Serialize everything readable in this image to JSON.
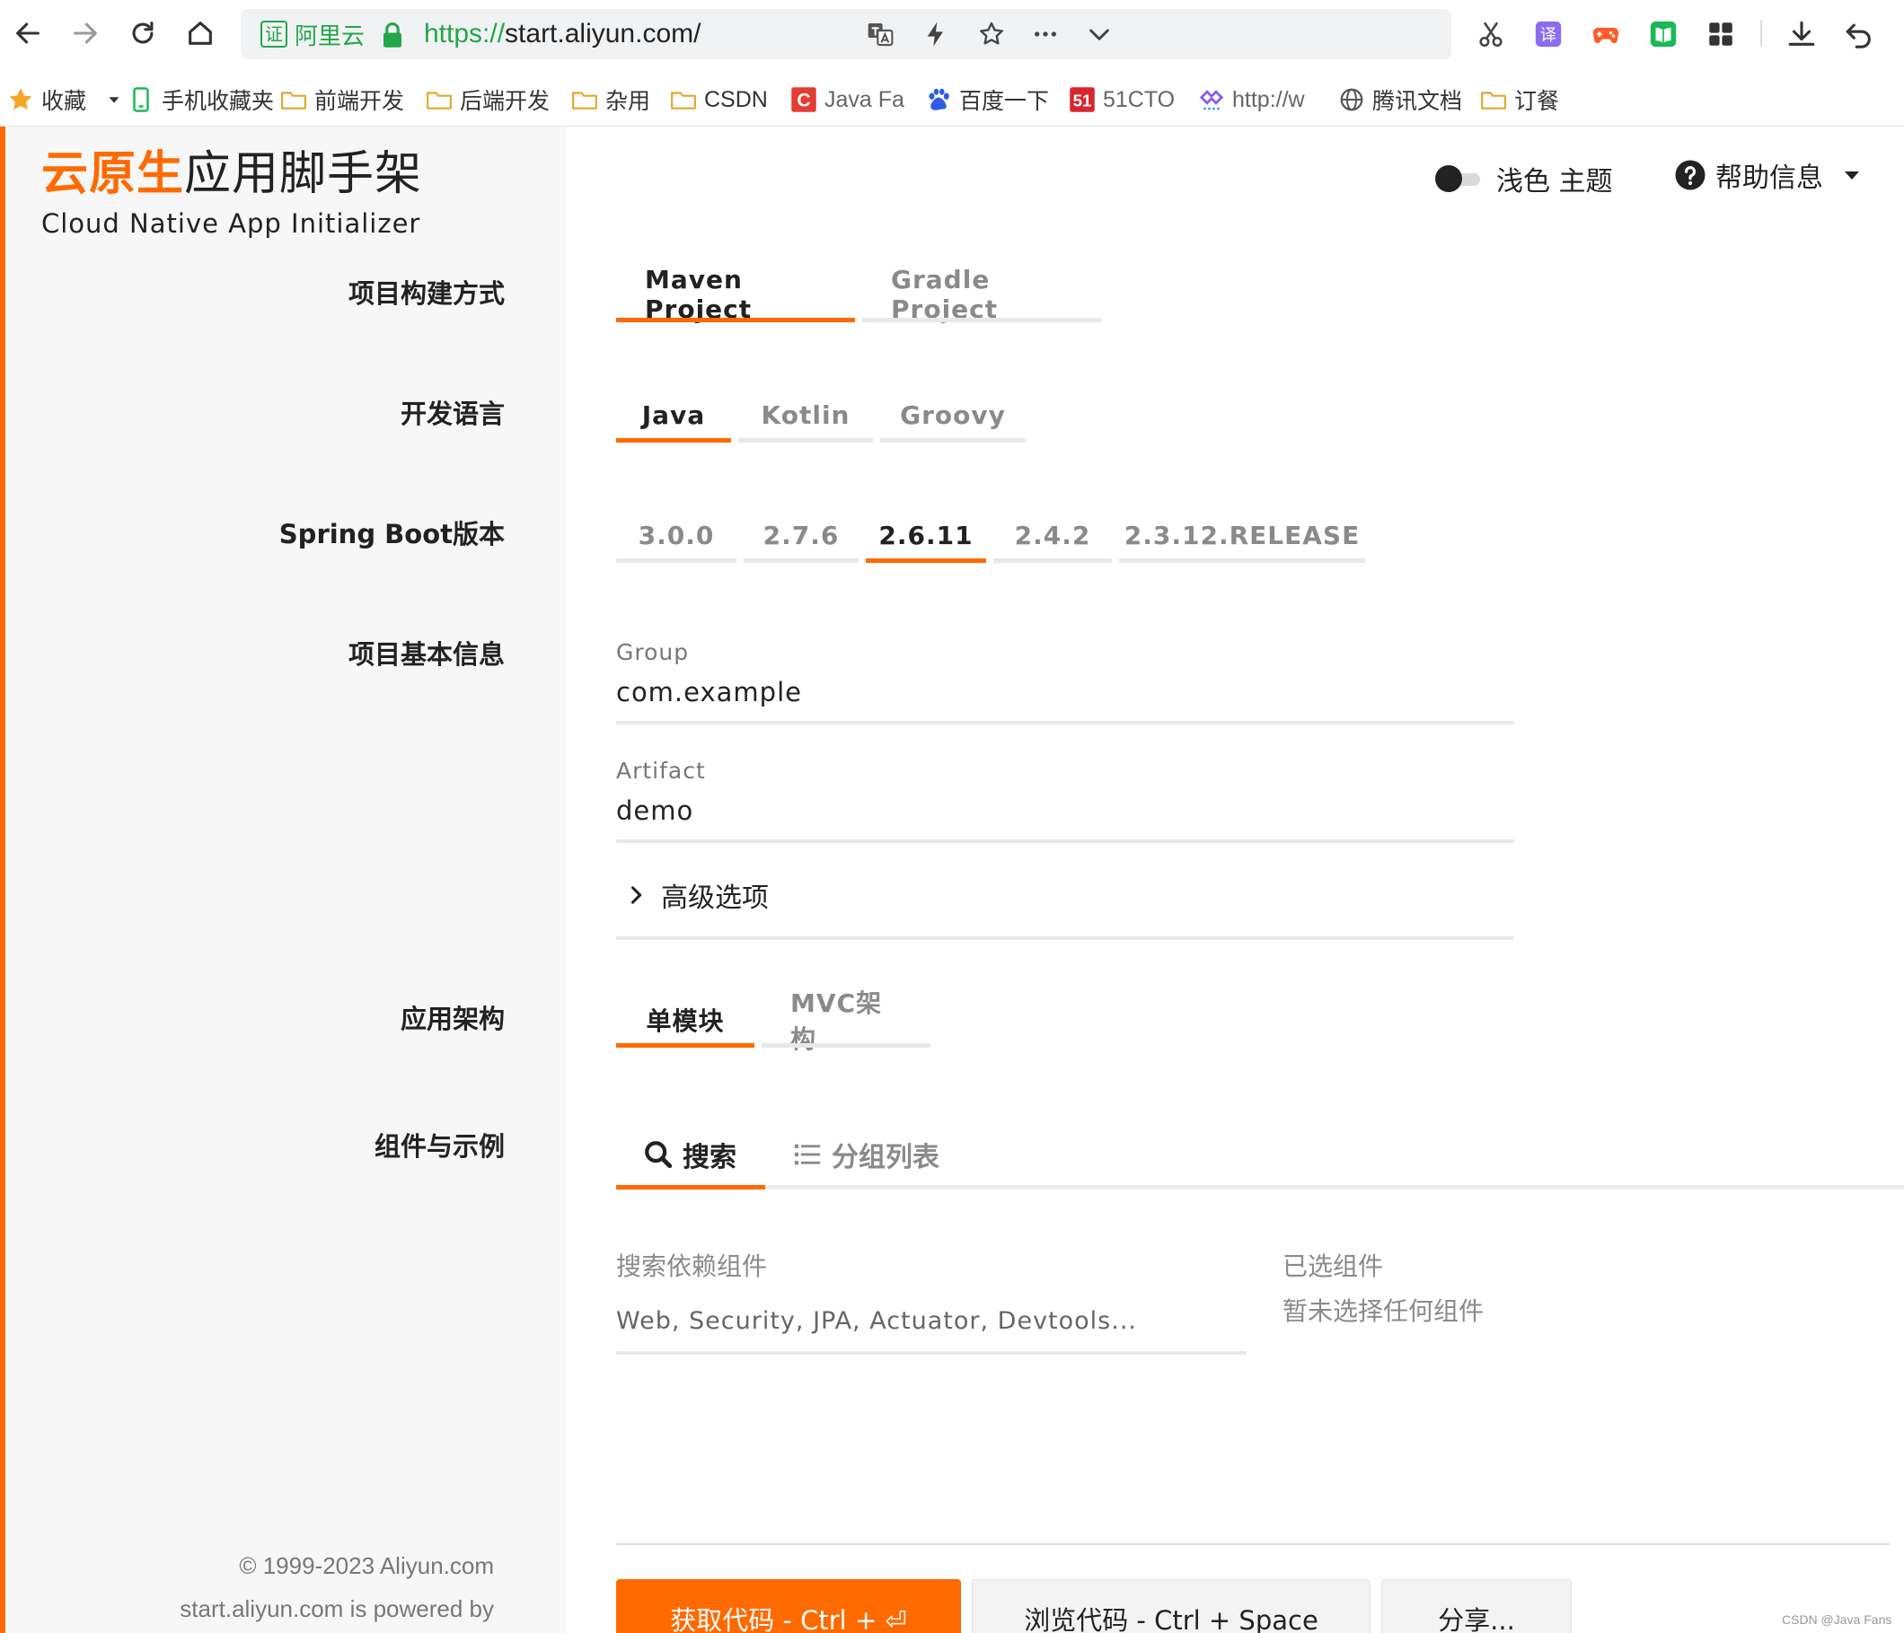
{
  "browser": {
    "cert_label": "阿里云",
    "cert_char": "证",
    "url_protocol": "https://",
    "url_rest": "start.aliyun.com/",
    "bookmarks": [
      {
        "label": "收藏",
        "icon": "star-icon"
      },
      {
        "label": "手机收藏夹",
        "icon": "phone-icon"
      },
      {
        "label": "前端开发",
        "icon": "folder-icon"
      },
      {
        "label": "后端开发",
        "icon": "folder-icon"
      },
      {
        "label": "杂用",
        "icon": "folder-icon"
      },
      {
        "label": "CSDN",
        "icon": "folder-icon"
      },
      {
        "label": "Java Fa",
        "icon": "csdn-c-icon"
      },
      {
        "label": "百度一下",
        "icon": "baidu-paw-icon"
      },
      {
        "label": "51CTO",
        "icon": "51cto-icon"
      },
      {
        "label": "http://w",
        "icon": "link-icon"
      },
      {
        "label": "腾讯文档",
        "icon": "globe-icon"
      },
      {
        "label": "订餐",
        "icon": "folder-icon"
      }
    ]
  },
  "colors": {
    "accent": "#ff6a00",
    "secure": "#22a64a",
    "sidebar_bg": "#f7f7f7"
  },
  "brand": {
    "title_highlight": "云原生",
    "title_rest": "应用脚手架",
    "subtitle": "Cloud Native App Initializer"
  },
  "header": {
    "theme_label": "浅色 主题",
    "help_label": "帮助信息"
  },
  "labels": {
    "build": "项目构建方式",
    "language": "开发语言",
    "boot_version": "Spring Boot版本",
    "basic_info": "项目基本信息",
    "architecture": "应用架构",
    "components": "组件与示例"
  },
  "build_tabs": [
    {
      "label": "Maven Project",
      "active": true
    },
    {
      "label": "Gradle Project",
      "active": false
    }
  ],
  "language_tabs": [
    {
      "label": "Java",
      "active": true
    },
    {
      "label": "Kotlin",
      "active": false
    },
    {
      "label": "Groovy",
      "active": false
    }
  ],
  "version_tabs": [
    {
      "label": "3.0.0",
      "active": false
    },
    {
      "label": "2.7.6",
      "active": false
    },
    {
      "label": "2.6.11",
      "active": true
    },
    {
      "label": "2.4.2",
      "active": false
    },
    {
      "label": "2.3.12.RELEASE",
      "active": false
    }
  ],
  "basic_info": {
    "group_label": "Group",
    "group_value": "com.example",
    "artifact_label": "Artifact",
    "artifact_value": "demo",
    "advanced_label": "高级选项"
  },
  "architecture_tabs": [
    {
      "label": "单模块",
      "active": true
    },
    {
      "label": "MVC架构",
      "active": false
    }
  ],
  "dependency": {
    "tab_search": "搜索",
    "tab_group": "分组列表",
    "search_label": "搜索依赖组件",
    "search_placeholder": "Web, Security, JPA, Actuator, Devtools...",
    "selected_label": "已选组件",
    "selected_empty": "暂未选择任何组件"
  },
  "actions": {
    "get_code": "获取代码 - Ctrl + ⏎",
    "browse": "浏览代码 - Ctrl + Space",
    "share": "分享..."
  },
  "footer": {
    "copyright": "© 1999-2023 Aliyun.com",
    "powered": "start.aliyun.com is powered by"
  },
  "watermark": "CSDN @Java Fans"
}
